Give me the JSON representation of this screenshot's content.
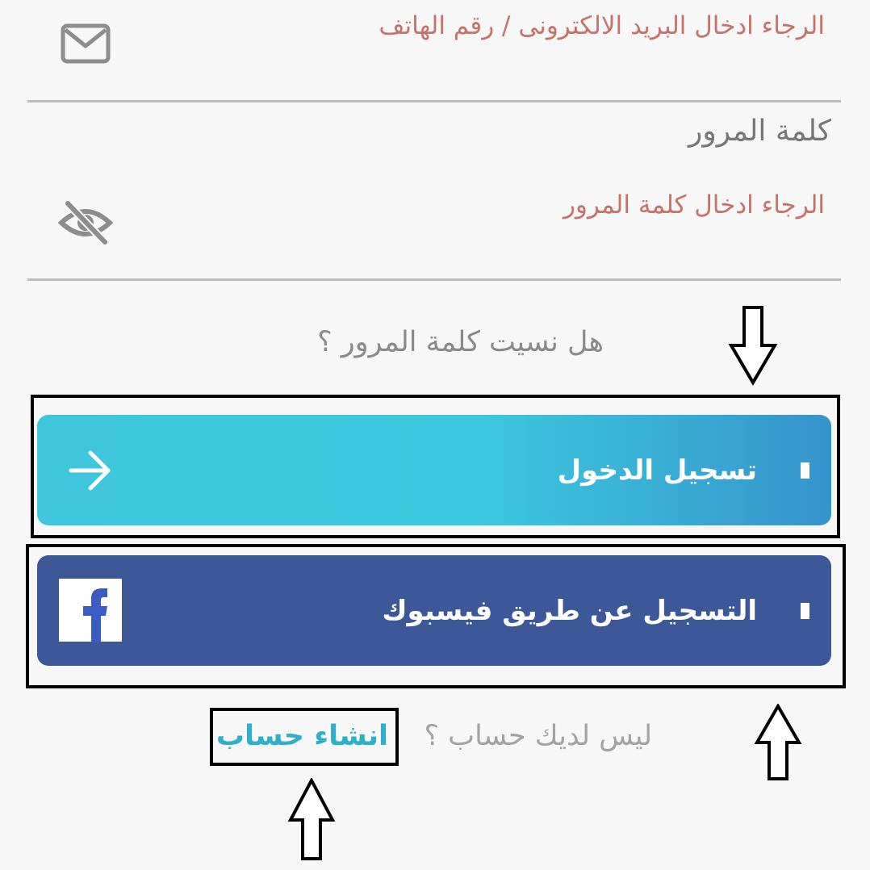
{
  "email": {
    "placeholder": "الرجاء ادخال البريد الالكترونى / رقم الهاتف",
    "icon": "mail-icon"
  },
  "password": {
    "label": "كلمة المرور",
    "placeholder": "الرجاء ادخال كلمة المرور",
    "icon": "eye-off-icon"
  },
  "forgot_password": "هل نسيت كلمة المرور ؟",
  "login_button": {
    "label": "تسجيل الدخول",
    "icon": "arrow-right-icon"
  },
  "facebook_button": {
    "label": "التسجيل عن طريق فيسبوك",
    "icon": "facebook-icon"
  },
  "signup": {
    "prompt": "ليس لديك حساب ؟",
    "link": "انشاء حساب"
  },
  "colors": {
    "placeholder": "#c4736a",
    "login_start": "#3ec7dc",
    "login_end": "#3694cc",
    "facebook": "#3c5898",
    "link": "#2fb0c8"
  }
}
